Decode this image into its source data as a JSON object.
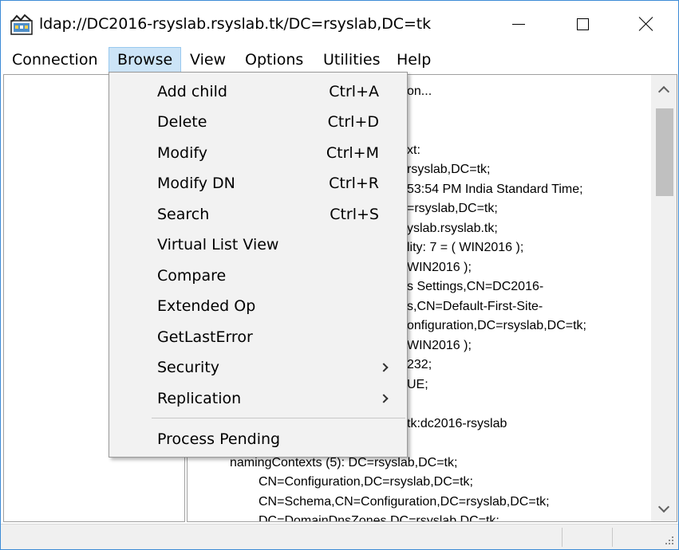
{
  "window": {
    "title": "ldap://DC2016-rsyslab.rsyslab.tk/DC=rsyslab,DC=tk"
  },
  "menubar": [
    {
      "label": "Connection"
    },
    {
      "label": "Browse"
    },
    {
      "label": "View"
    },
    {
      "label": "Options"
    },
    {
      "label": "Utilities"
    },
    {
      "label": "Help"
    }
  ],
  "browse_menu": {
    "items": [
      {
        "label": "Add child",
        "shortcut": "Ctrl+A"
      },
      {
        "label": "Delete",
        "shortcut": "Ctrl+D"
      },
      {
        "label": "Modify",
        "shortcut": "Ctrl+M"
      },
      {
        "label": "Modify DN",
        "shortcut": "Ctrl+R"
      },
      {
        "label": "Search",
        "shortcut": "Ctrl+S"
      },
      {
        "label": "Virtual List View",
        "shortcut": ""
      },
      {
        "label": "Compare",
        "shortcut": ""
      },
      {
        "label": "Extended Op",
        "shortcut": ""
      },
      {
        "label": "GetLastError",
        "shortcut": ""
      },
      {
        "label": "Security",
        "shortcut": "",
        "submenu": true
      },
      {
        "label": "Replication",
        "shortcut": "",
        "submenu": true
      },
      {
        "label": "Process Pending",
        "shortcut": ""
      }
    ]
  },
  "output": {
    "lines": [
      "on...",
      "xt:",
      "rsyslab,DC=tk;",
      "53:54 PM India Standard Time;",
      "=rsyslab,DC=tk;",
      "yslab.rsyslab.tk;",
      "lity: 7 = ( WIN2016 );",
      "WIN2016 );",
      "s Settings,CN=DC2016-",
      "s,CN=Default-First-Site-",
      "onfiguration,DC=rsyslab,DC=tk;",
      "WIN2016 );",
      "232;",
      "UE;",
      "tk:dc2016-rsyslab",
      "namingContexts (5): DC=rsyslab,DC=tk;",
      "CN=Configuration,DC=rsyslab,DC=tk;",
      "CN=Schema,CN=Configuration,DC=rsyslab,DC=tk;",
      "DC=DomainDnsZones,DC=rsyslab,DC=tk;"
    ]
  },
  "colors": {
    "menu_active_bg": "#cce4f7",
    "menu_active_border": "#99c9ef",
    "dropdown_bg": "#f2f2f2",
    "window_border": "#3d8bd6"
  }
}
